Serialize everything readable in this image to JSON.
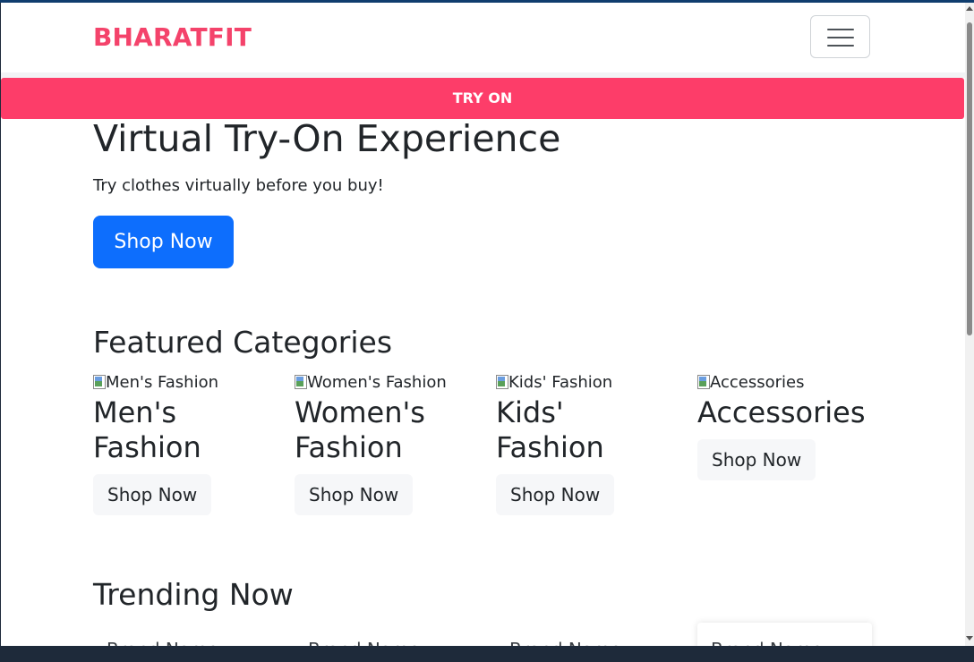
{
  "navbar": {
    "brand": "BHARATFIT",
    "menu_icon": "hamburger-menu-icon"
  },
  "banner": {
    "label": "TRY ON"
  },
  "hero": {
    "title": "Virtual Try-On Experience",
    "subtitle": "Try clothes virtually before you buy!",
    "cta": "Shop Now"
  },
  "featured": {
    "title": "Featured Categories",
    "items": [
      {
        "alt": "Men's Fashion",
        "name": "Men's Fashion",
        "button": "Shop Now"
      },
      {
        "alt": "Women's Fashion",
        "name": "Women's Fashion",
        "button": "Shop Now"
      },
      {
        "alt": "Kids' Fashion",
        "name": "Kids' Fashion",
        "button": "Shop Now"
      },
      {
        "alt": "Accessories",
        "name": "Accessories",
        "button": "Shop Now"
      }
    ]
  },
  "trending": {
    "title": "Trending Now",
    "items": [
      {
        "brand": "Brand Name"
      },
      {
        "brand": "Brand Name"
      },
      {
        "brand": "Brand Name"
      },
      {
        "brand": "Brand Name"
      }
    ]
  },
  "colors": {
    "brand": "#f4436b",
    "banner": "#fd3d69",
    "primary": "#0d6efd"
  }
}
